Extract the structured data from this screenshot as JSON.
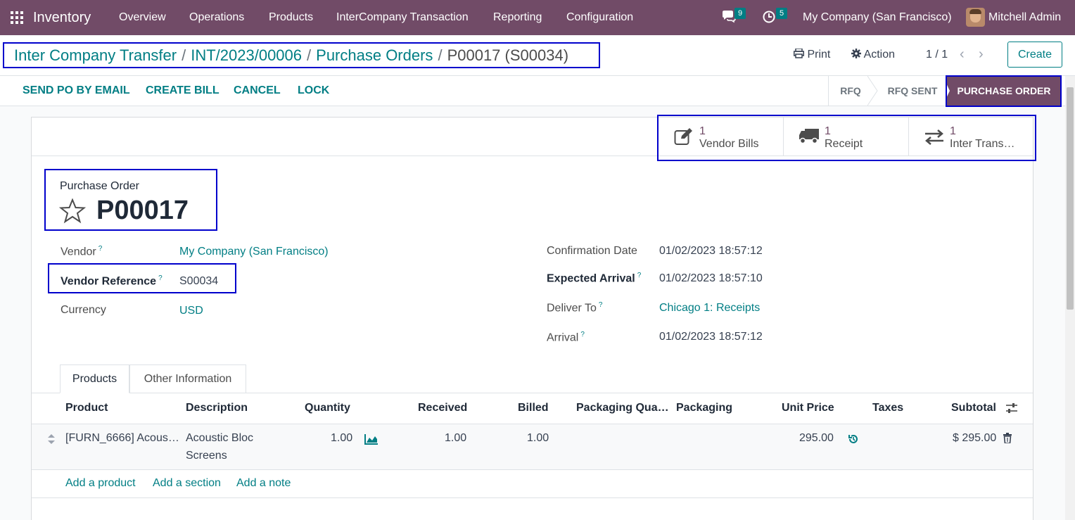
{
  "navbar": {
    "app_name": "Inventory",
    "menu": [
      "Overview",
      "Operations",
      "Products",
      "InterCompany Transaction",
      "Reporting",
      "Configuration"
    ],
    "messages_count": "9",
    "activities_count": "5",
    "company": "My Company (San Francisco)",
    "user": "Mitchell Admin"
  },
  "breadcrumb": {
    "items": [
      "Inter Company Transfer",
      "INT/2023/00006",
      "Purchase Orders"
    ],
    "separator": "/",
    "current": "P00017 (S00034)"
  },
  "toolbar": {
    "print": "Print",
    "action": "Action",
    "pager": "1 / 1",
    "create": "Create"
  },
  "statusbar": {
    "buttons": [
      "SEND PO BY EMAIL",
      "CREATE BILL",
      "CANCEL",
      "LOCK"
    ],
    "stages": [
      "RFQ",
      "RFQ SENT",
      "PURCHASE ORDER"
    ],
    "active_stage": "PURCHASE ORDER"
  },
  "smart_buttons": [
    {
      "count": "1",
      "label": "Vendor Bills",
      "icon": "pencil-square-icon"
    },
    {
      "count": "1",
      "label": "Receipt",
      "icon": "truck-icon"
    },
    {
      "count": "1",
      "label": "Inter Trans…",
      "icon": "exchange-icon"
    }
  ],
  "record": {
    "type_label": "Purchase Order",
    "name": "P00017"
  },
  "fields_left": {
    "vendor_label": "Vendor",
    "vendor_value": "My Company (San Francisco)",
    "vendor_ref_label": "Vendor Reference",
    "vendor_ref_value": "S00034",
    "currency_label": "Currency",
    "currency_value": "USD"
  },
  "fields_right": {
    "confirmation_label": "Confirmation Date",
    "confirmation_value": "01/02/2023 18:57:12",
    "expected_label": "Expected Arrival",
    "expected_value": "01/02/2023 18:57:10",
    "deliver_label": "Deliver To",
    "deliver_value": "Chicago 1: Receipts",
    "arrival_label": "Arrival",
    "arrival_value": "01/02/2023 18:57:12"
  },
  "help_marker": "?",
  "tabs": [
    "Products",
    "Other Information"
  ],
  "table": {
    "headers": [
      "Product",
      "Description",
      "Quantity",
      "Received",
      "Billed",
      "Packaging Qua…",
      "Packaging",
      "Unit Price",
      "Taxes",
      "Subtotal"
    ],
    "rows": [
      {
        "product": "[FURN_6666] Acous…",
        "description_line1": "Acoustic Bloc",
        "description_line2": "Screens",
        "quantity": "1.00",
        "received": "1.00",
        "billed": "1.00",
        "unit_price": "295.00",
        "subtotal": "$ 295.00"
      }
    ],
    "add_links": [
      "Add a product",
      "Add a section",
      "Add a note"
    ]
  },
  "colors": {
    "brand": "#714b67",
    "accent": "#017e84",
    "highlight_box": "#0000cc"
  }
}
